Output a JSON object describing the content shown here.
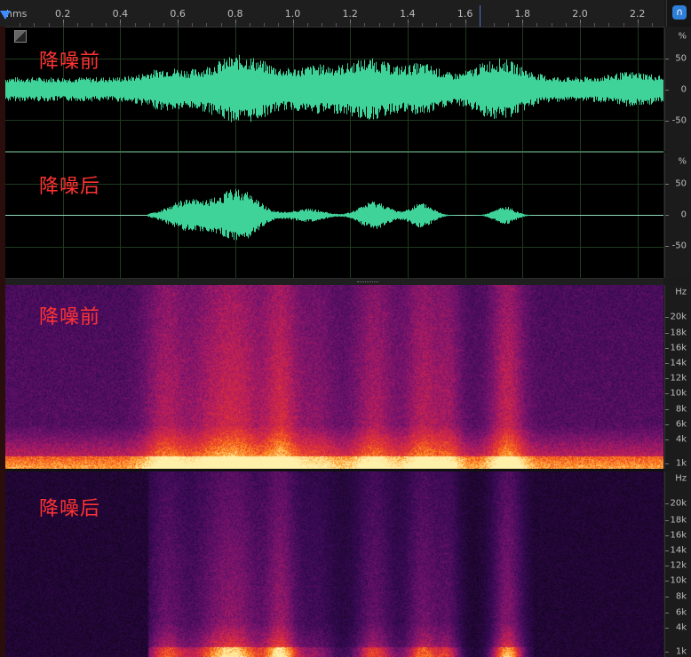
{
  "ruler": {
    "unit": "hms",
    "ticks": [
      "0.2",
      "0.4",
      "0.6",
      "0.8",
      "1.0",
      "1.2",
      "1.4",
      "1.6",
      "1.8",
      "2.0",
      "2.2"
    ]
  },
  "waveform_top": {
    "label": "降噪前",
    "scale": [
      "%",
      "50",
      "0",
      "-50"
    ]
  },
  "waveform_bottom": {
    "label": "降噪后",
    "scale": [
      "%",
      "50",
      "0",
      "-50"
    ]
  },
  "spectrogram_top": {
    "label": "降噪前",
    "scale": [
      "Hz",
      "20k",
      "18k",
      "16k",
      "14k",
      "12k",
      "10k",
      "8k",
      "6k",
      "4k",
      "1k"
    ]
  },
  "spectrogram_bottom": {
    "label": "降噪后",
    "scale": [
      "Hz",
      "20k",
      "18k",
      "16k",
      "14k",
      "12k",
      "10k",
      "8k",
      "6k",
      "4k",
      "1k"
    ]
  },
  "colors": {
    "waveform": "#3fd39a",
    "label": "#ff3333",
    "accent": "#2f7fd8"
  }
}
